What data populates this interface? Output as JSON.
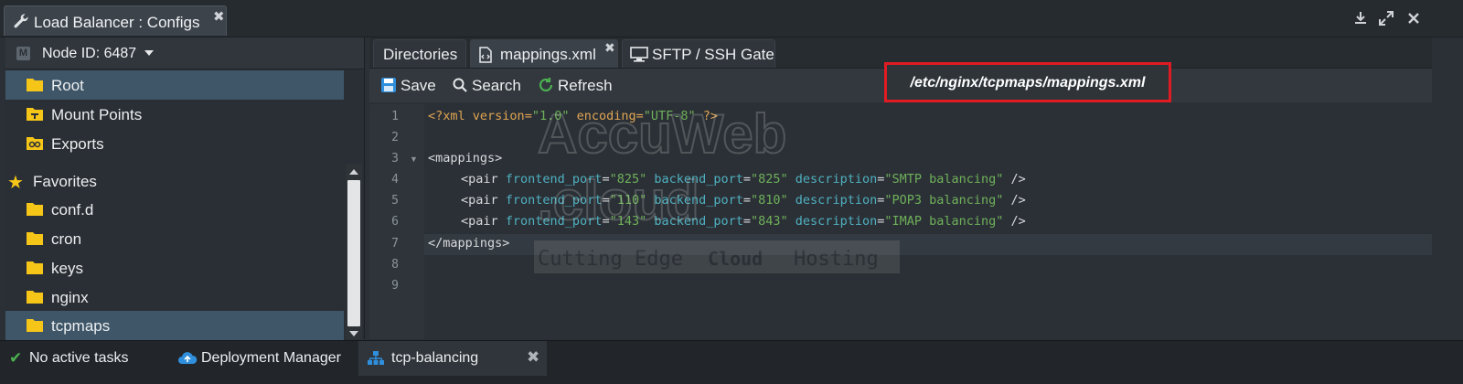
{
  "window": {
    "title": "Load Balancer : Configs",
    "close_glyph": "✖"
  },
  "node": {
    "label": "Node ID: 6487",
    "badge": "M"
  },
  "tree": {
    "root_items": [
      {
        "label": "Root",
        "icon": "folder-icon",
        "selected": true
      },
      {
        "label": "Mount Points",
        "icon": "mount-folder-icon"
      },
      {
        "label": "Exports",
        "icon": "exports-folder-icon"
      }
    ],
    "favorites_label": "Favorites",
    "favorites": [
      {
        "label": "conf.d",
        "icon": "folder-icon"
      },
      {
        "label": "cron",
        "icon": "folder-icon"
      },
      {
        "label": "keys",
        "icon": "folder-icon"
      },
      {
        "label": "nginx",
        "icon": "folder-icon"
      },
      {
        "label": "tcpmaps",
        "icon": "folder-icon",
        "selected": true
      }
    ]
  },
  "tabs": [
    {
      "label": "Directories",
      "icon": ""
    },
    {
      "label": "mappings.xml",
      "icon": "xml-file-icon",
      "active": true,
      "closable": true,
      "close_glyph": "✖"
    },
    {
      "label": "SFTP / SSH Gate",
      "icon": "monitor-icon"
    }
  ],
  "toolbar": {
    "save_label": "Save",
    "search_label": "Search",
    "refresh_label": "Refresh",
    "path": "/etc/nginx/tcpmaps/mappings.xml"
  },
  "editor": {
    "line_numbers": [
      "1",
      "2",
      "3",
      "4",
      "5",
      "6",
      "7",
      "8",
      "9"
    ],
    "line1": {
      "open": "<?xml ",
      "a1": "version",
      "eq": "=",
      "v1": "\"1.0\"",
      "a2": " encoding",
      "v2": "\"UTF-8\"",
      "close": " ?>"
    },
    "line3": "<mappings>",
    "pairs": [
      {
        "tag": "<pair",
        "a1": " frontend_port",
        "v1": "\"825\"",
        "a2": " backend_port",
        "v2": "\"825\"",
        "a3": " description",
        "v3": "\"SMTP balancing\"",
        "end": " />"
      },
      {
        "tag": "<pair",
        "a1": " frontend_port",
        "v1": "\"110\"",
        "a2": " backend_port",
        "v2": "\"810\"",
        "a3": " description",
        "v3": "\"POP3 balancing\"",
        "end": " />"
      },
      {
        "tag": "<pair",
        "a1": " frontend_port",
        "v1": "\"143\"",
        "a2": " backend_port",
        "v2": "\"843\"",
        "a3": " description",
        "v3": "\"IMAP balancing\"",
        "end": " />"
      }
    ],
    "line7": "</mappings>"
  },
  "watermark": {
    "line1": "AccuWeb",
    "line2": ".cloud",
    "tagline_left": "Cutting Edge",
    "tagline_mid": "Cloud",
    "tagline_right": "Hosting"
  },
  "bottom": {
    "tasks_label": "No active tasks",
    "deployment_label": "Deployment Manager",
    "env_label": "tcp-balancing",
    "close_glyph": "✖"
  },
  "colors": {
    "accent_red": "#e11b22",
    "folder_yellow": "#f5c518",
    "selected_row": "#3e5668"
  }
}
